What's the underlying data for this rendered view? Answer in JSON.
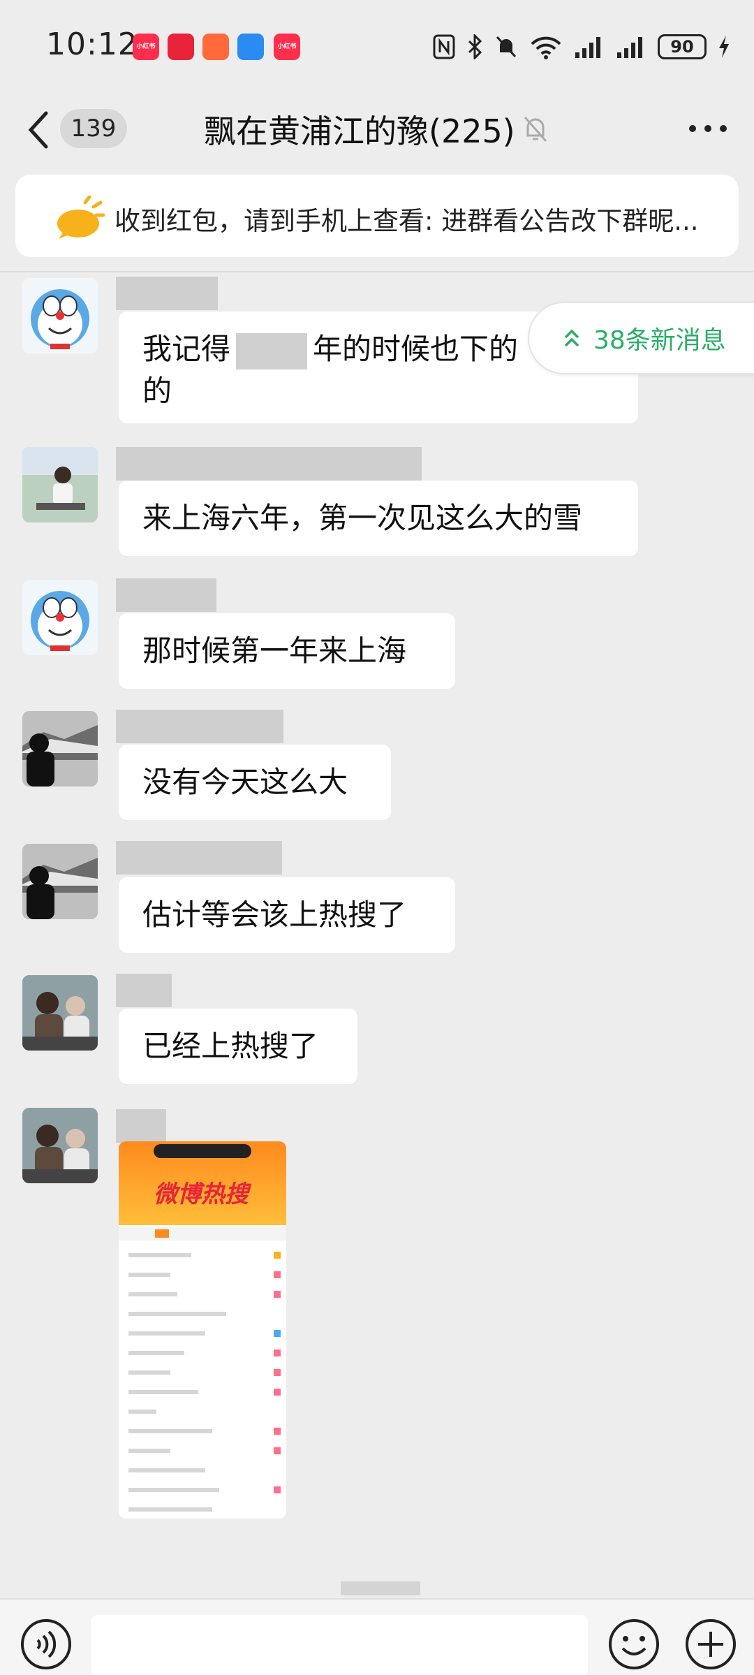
{
  "status_bar": {
    "time": "10:12",
    "app_badges": [
      "小红书",
      "",
      "",
      "",
      "小红书"
    ],
    "battery": "90"
  },
  "header": {
    "back_count": "139",
    "title": "飘在黄浦江的豫(225)"
  },
  "notice": {
    "text": "收到红包，请到手机上查看: 进群看公告改下群昵..."
  },
  "new_messages": {
    "label": "38条新消息"
  },
  "messages": [
    {
      "line1_before": "我记得",
      "line1_after": "年的时候也下的",
      "line2": "的"
    },
    {
      "text": "来上海六年，第一次见这么大的雪"
    },
    {
      "text": "那时候第一年来上海"
    },
    {
      "text": "没有今天这么大"
    },
    {
      "text": "估计等会该上热搜了"
    },
    {
      "text": "已经上热搜了"
    }
  ],
  "image_message": {
    "title": "微博热搜"
  },
  "colors": {
    "background": "#ededed",
    "accent_green": "#2aae67",
    "bubble": "#ffffff"
  }
}
